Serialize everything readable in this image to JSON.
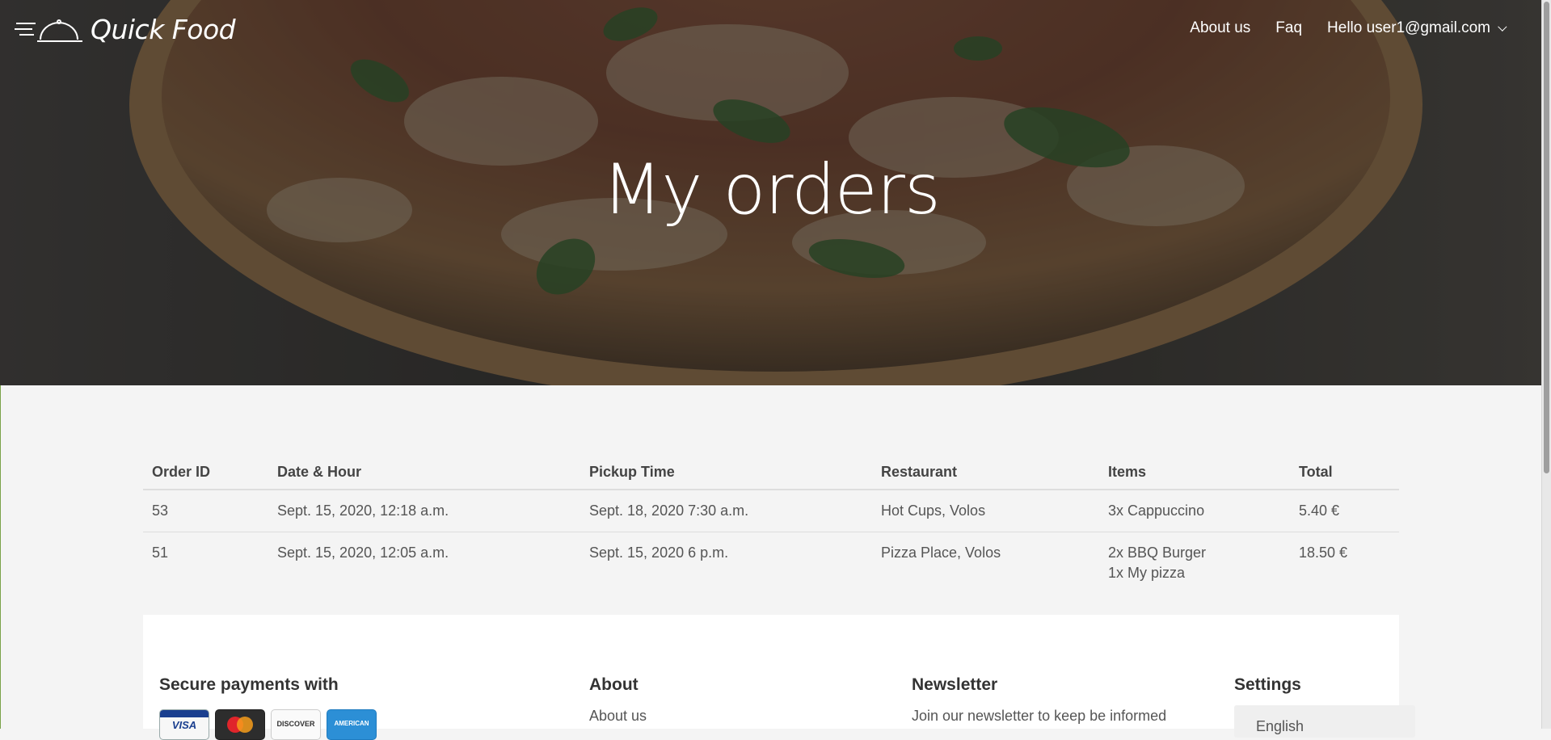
{
  "brand": {
    "name": "Quick Food"
  },
  "nav": {
    "about": "About us",
    "faq": "Faq",
    "user": "Hello user1@gmail.com"
  },
  "hero": {
    "title": "My orders"
  },
  "orders": {
    "headers": [
      "Order ID",
      "Date & Hour",
      "Pickup Time",
      "Restaurant",
      "Items",
      "Total"
    ],
    "rows": [
      {
        "id": "53",
        "date": "Sept. 15, 2020, 12:18 a.m.",
        "pickup": "Sept. 18, 2020 7:30 a.m.",
        "restaurant": "Hot Cups, Volos",
        "items": [
          "3x Cappuccino"
        ],
        "total": "5.40 €"
      },
      {
        "id": "51",
        "date": "Sept. 15, 2020, 12:05 a.m.",
        "pickup": "Sept. 15, 2020 6 p.m.",
        "restaurant": "Pizza Place, Volos",
        "items": [
          "2x BBQ Burger",
          "1x My pizza"
        ],
        "total": "18.50 €"
      }
    ]
  },
  "footer": {
    "payments_title": "Secure payments with",
    "cards": [
      "VISA",
      "MasterCard",
      "DISCOVER",
      "AMERICAN"
    ],
    "about_title": "About",
    "about_link": "About us",
    "newsletter_title": "Newsletter",
    "newsletter_text": "Join our newsletter to keep be informed",
    "settings_title": "Settings",
    "language": "English"
  },
  "colors": {
    "hero_overlay": "#3b3a38",
    "page_bg": "#f4f4f4",
    "footer_bg": "#ffffff"
  },
  "icons": [
    "cloche-logo-icon",
    "chevron-down-icon",
    "visa-card-icon",
    "mastercard-card-icon",
    "discover-card-icon",
    "amex-card-icon"
  ]
}
